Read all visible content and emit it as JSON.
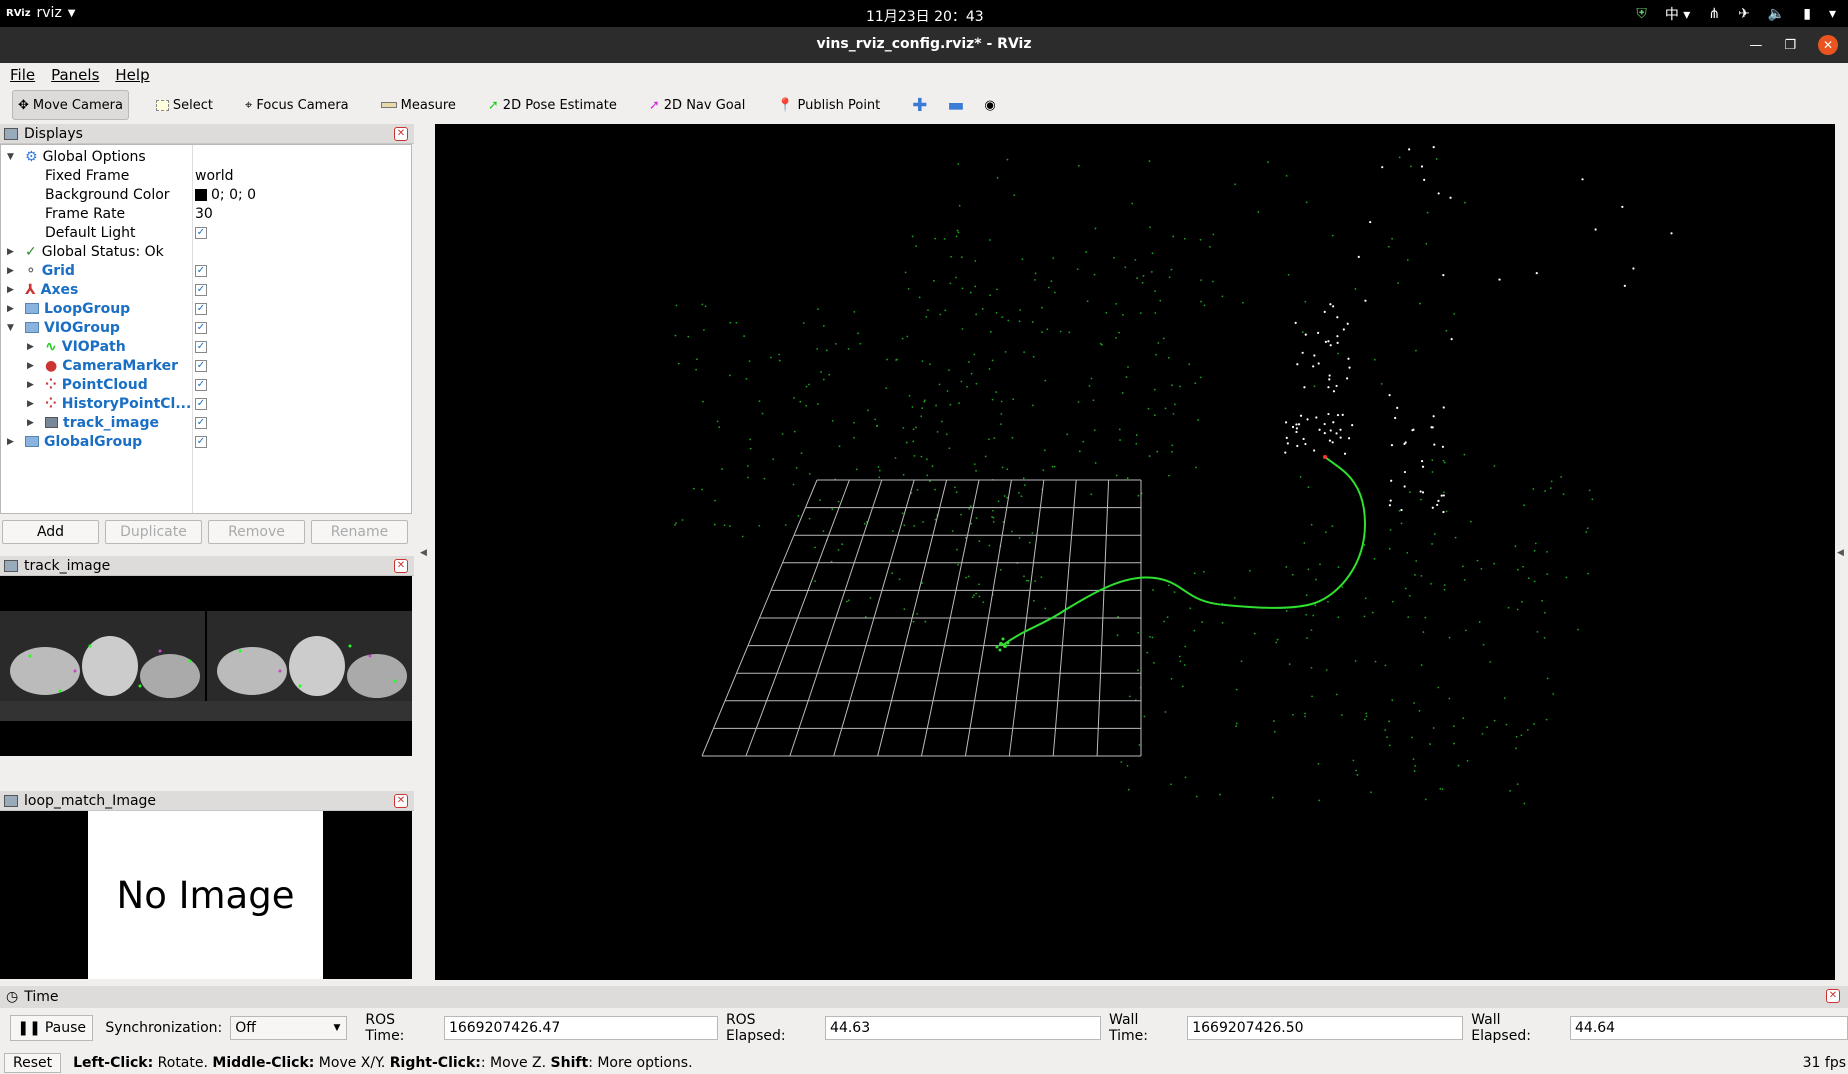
{
  "system_bar": {
    "app_name": "rviz",
    "clock": "11月23日  20：43",
    "ime": "中"
  },
  "window": {
    "title": "vins_rviz_config.rviz* - RViz"
  },
  "menu": [
    "File",
    "Panels",
    "Help"
  ],
  "toolbar": {
    "tools": [
      {
        "label": "Move Camera",
        "icon": "move-camera-icon",
        "active": true
      },
      {
        "label": "Select",
        "icon": "select-icon"
      },
      {
        "label": "Focus Camera",
        "icon": "focus-camera-icon"
      },
      {
        "label": "Measure",
        "icon": "ruler-icon"
      },
      {
        "label": "2D Pose Estimate",
        "icon": "pose-arrow-icon"
      },
      {
        "label": "2D Nav Goal",
        "icon": "nav-arrow-icon"
      },
      {
        "label": "Publish Point",
        "icon": "pin-icon"
      }
    ]
  },
  "displays": {
    "title": "Displays",
    "global_options": "Global Options",
    "fixed_frame_label": "Fixed Frame",
    "fixed_frame_value": "world",
    "bg_color_label": "Background Color",
    "bg_color_value": "0; 0; 0",
    "frame_rate_label": "Frame Rate",
    "frame_rate_value": "30",
    "default_light_label": "Default Light",
    "global_status": "Global Status: Ok",
    "items": [
      {
        "label": "Grid",
        "indent": 0
      },
      {
        "label": "Axes",
        "indent": 0
      },
      {
        "label": "LoopGroup",
        "indent": 0
      },
      {
        "label": "VIOGroup",
        "indent": 0
      },
      {
        "label": "VIOPath",
        "indent": 1
      },
      {
        "label": "CameraMarker",
        "indent": 1
      },
      {
        "label": "PointCloud",
        "indent": 1
      },
      {
        "label": "HistoryPointCl...",
        "indent": 1
      },
      {
        "label": "track_image",
        "indent": 1
      },
      {
        "label": "GlobalGroup",
        "indent": 0
      }
    ],
    "buttons": {
      "add": "Add",
      "duplicate": "Duplicate",
      "remove": "Remove",
      "rename": "Rename"
    }
  },
  "track_panel": {
    "title": "track_image"
  },
  "loop_panel": {
    "title": "loop_match_Image",
    "no_image": "No Image"
  },
  "time_panel": {
    "title": "Time",
    "pause": "Pause",
    "sync_label": "Synchronization:",
    "sync_value": "Off",
    "ros_time_label": "ROS Time:",
    "ros_time_value": "1669207426.47",
    "ros_elapsed_label": "ROS Elapsed:",
    "ros_elapsed_value": "44.63",
    "wall_time_label": "Wall Time:",
    "wall_time_value": "1669207426.50",
    "wall_elapsed_label": "Wall Elapsed:",
    "wall_elapsed_value": "44.64"
  },
  "status_bar": {
    "reset": "Reset",
    "left_click_label": "Left-Click:",
    "left_click_text": " Rotate. ",
    "middle_click_label": "Middle-Click:",
    "middle_click_text": " Move X/Y. ",
    "right_click_label": "Right-Click:",
    "right_click_text": ": Move Z. ",
    "shift_label": "Shift",
    "shift_text": ": More options.",
    "fps": "31 fps"
  }
}
